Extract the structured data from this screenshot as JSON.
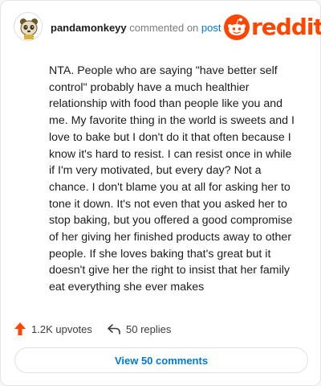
{
  "header": {
    "username": "pandamonkeyy",
    "action_text": "commented on",
    "link_text": "post",
    "logo_text": "reddit"
  },
  "comment": {
    "text": "NTA. People who are saying \"have better self control\" probably have a much healthier relationship with food than people like you and me. My favorite thing in the world is sweets and I love to bake but I don't do it that often because I know it's hard to resist. I can resist once in while if I'm very motivated, but every day? Not a chance. I don't blame you at all for asking her to tone it down. It's not even that you asked her to stop baking, but you offered a good compromise of her giving her finished products away to other people. If she loves baking that's great but it doesn't give her the right to insist that her family eat everything she ever makes"
  },
  "actions": {
    "upvotes": "1.2K upvotes",
    "replies": "50 replies"
  },
  "view_button": "View 50 comments",
  "colors": {
    "brand": "#ff4500",
    "link": "#0079d3",
    "text": "#1c1c1c",
    "muted": "#7c7c7c"
  }
}
